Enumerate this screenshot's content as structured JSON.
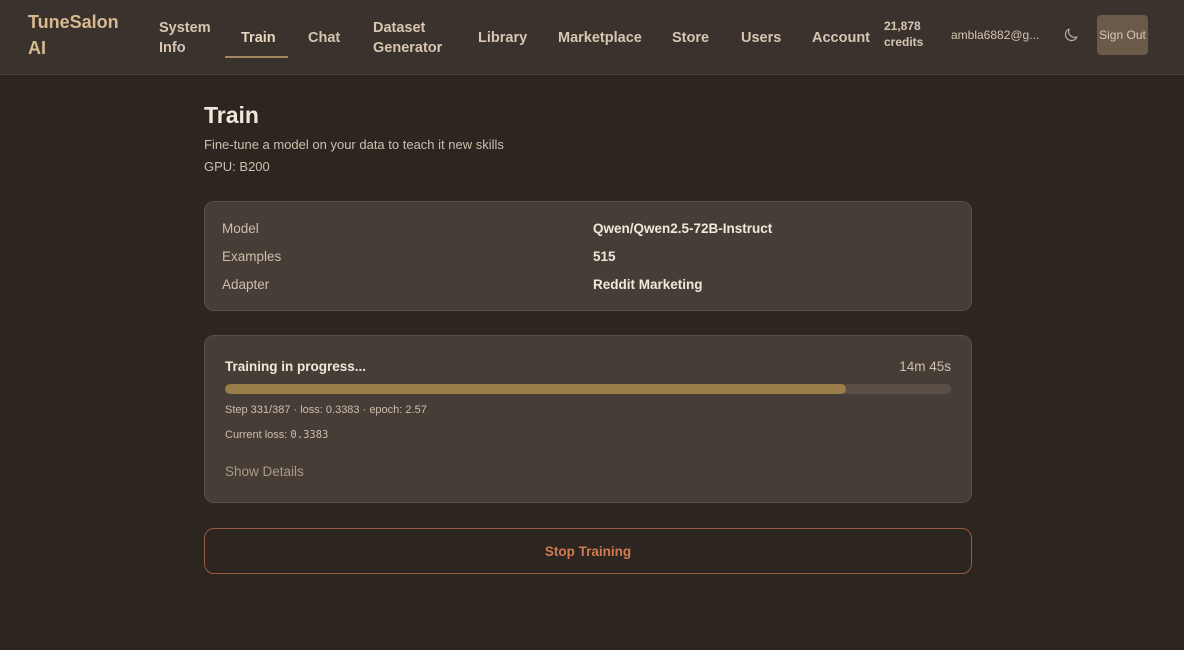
{
  "brand": "TuneSalon AI",
  "nav": {
    "system_info": "System Info",
    "train": "Train",
    "chat": "Chat",
    "dataset_generator": "Dataset Generator",
    "library": "Library",
    "marketplace": "Marketplace",
    "store": "Store",
    "users": "Users",
    "account": "Account"
  },
  "header": {
    "credits": "21,878 credits",
    "email": "ambla6882@g...",
    "theme_icon": "moon-icon",
    "sign_out": "Sign Out"
  },
  "page": {
    "title": "Train",
    "subtitle": "Fine-tune a model on your data to teach it new skills",
    "gpu": "GPU: B200"
  },
  "info": {
    "model_label": "Model",
    "model_value": "Qwen/Qwen2.5-72B-Instruct",
    "examples_label": "Examples",
    "examples_value": "515",
    "adapter_label": "Adapter",
    "adapter_value": "Reddit Marketing"
  },
  "progress": {
    "title": "Training in progress...",
    "elapsed": "14m 45s",
    "fraction": 0.855,
    "step_text": "Step 331/387 · loss: 0.3383 · epoch: 2.57",
    "current_loss_label": "Current loss:",
    "current_loss_value": "0.3383",
    "show_details": "Show Details"
  },
  "actions": {
    "stop_training": "Stop Training"
  },
  "colors": {
    "background": "#2c2520",
    "accent": "#9a7d48",
    "danger": "#d17b52"
  }
}
